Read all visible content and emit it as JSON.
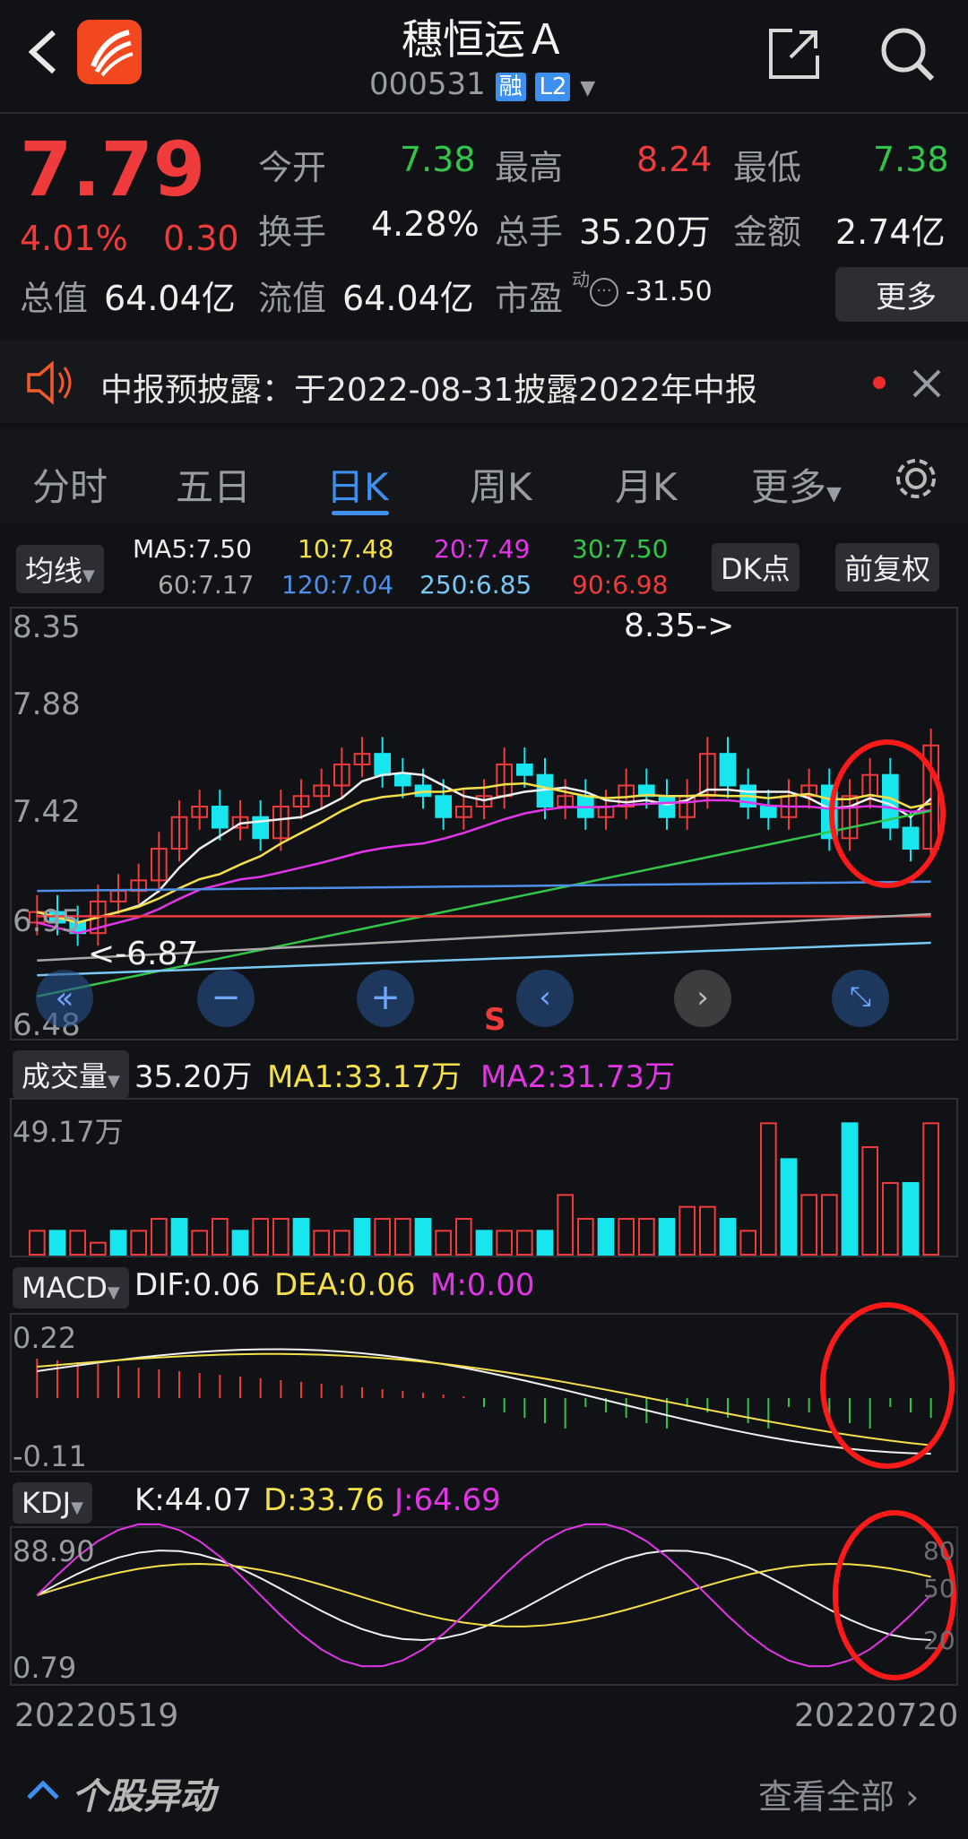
{
  "header": {
    "title": "穗恒运Ａ",
    "code": "000531",
    "badge_rong": "融",
    "badge_l2": "L2"
  },
  "quote": {
    "price": "7.79",
    "change_pct": "4.01%",
    "change": "0.30",
    "open_label": "今开",
    "open": "7.38",
    "high_label": "最高",
    "high": "8.24",
    "low_label": "最低",
    "low": "7.38",
    "turnover_label": "换手",
    "turnover": "4.28%",
    "volume_label": "总手",
    "volume": "35.20万",
    "amount_label": "金额",
    "amount": "2.74亿",
    "mktcap_label": "总值",
    "mktcap": "64.04亿",
    "float_label": "流值",
    "float_cap": "64.04亿",
    "pe_label": "市盈",
    "pe_sup": "动",
    "pe": "-31.50",
    "more_label": "更多"
  },
  "notice": {
    "text": "中报预披露：于2022-08-31披露2022年中报"
  },
  "tabs": [
    "分时",
    "五日",
    "日K",
    "周K",
    "月K",
    "更多"
  ],
  "active_tab": "日K",
  "ma": {
    "selector": "均线",
    "ma5": "MA5:7.50",
    "ma10": "10:7.48",
    "ma20": "20:7.49",
    "ma30": "30:7.50",
    "ma60": "60:7.17",
    "ma120": "120:7.04",
    "ma250": "250:6.85",
    "ma90": "90:6.98",
    "dk_button": "DK点",
    "adjust_button": "前复权"
  },
  "kline": {
    "ymax": "8.35",
    "y2": "7.88",
    "y3": "7.42",
    "y4": "6.95",
    "ymin": "6.48",
    "high_marker": "8.35->",
    "low_marker": "<-6.87",
    "s_marker": "S"
  },
  "volume": {
    "selector": "成交量",
    "value": "35.20万",
    "ma1": "MA1:33.17万",
    "ma2": "MA2:31.73万",
    "ymax": "49.17万"
  },
  "macd": {
    "selector": "MACD",
    "dif": "DIF:0.06",
    "dea": "DEA:0.06",
    "m": "M:0.00",
    "ymax": "0.22",
    "ymin": "-0.11"
  },
  "kdj": {
    "selector": "KDJ",
    "k": "K:44.07",
    "d": "D:33.76",
    "j": "J:64.69",
    "ymax": "88.90",
    "ymin": "0.79",
    "r80": "80",
    "r50": "50",
    "r20": "20"
  },
  "dates": {
    "start": "20220519",
    "end": "20220720"
  },
  "footer": {
    "section": "个股异动",
    "view_all": "查看全部"
  },
  "colors": {
    "up": "#ef3b3b",
    "down": "#18e6ee",
    "accent": "#3d8ff0"
  }
}
